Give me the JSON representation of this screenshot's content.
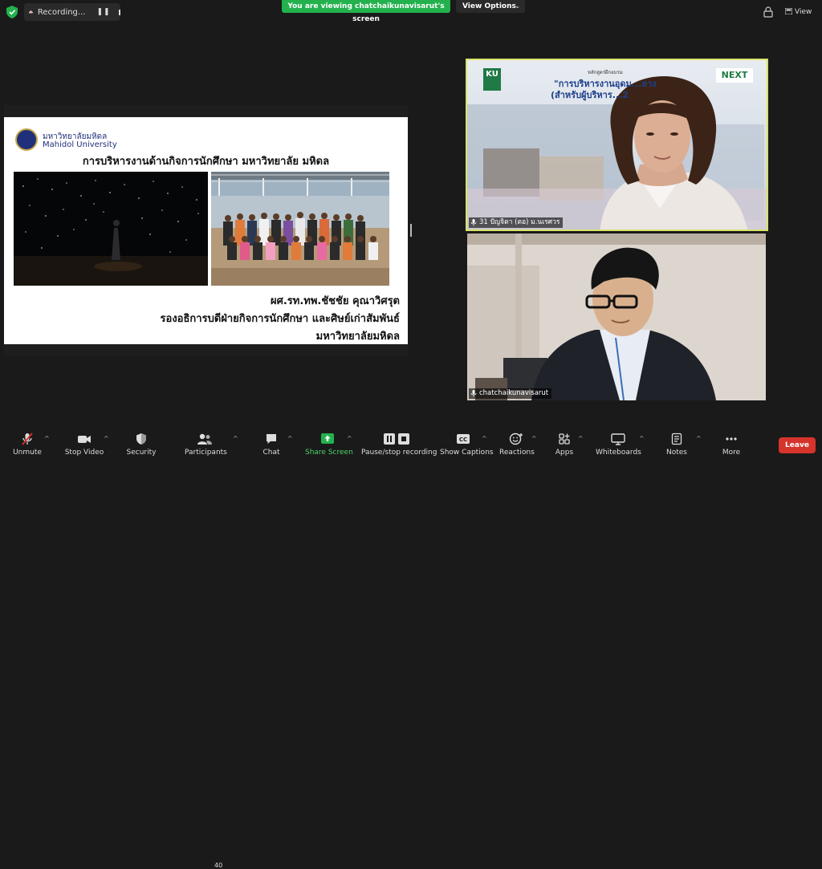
{
  "topbar": {
    "recording_label": "Recording...",
    "pause_symbol": "❚❚",
    "banner": "You are viewing chatchaikunavisarut's screen",
    "view_options": "View Options",
    "view_label": "View"
  },
  "slide": {
    "logo_thai": "มหาวิทยาลัยมหิดล",
    "logo_english": "Mahidol University",
    "title": "การบริหารงานด้านกิจการนักศึกษา มหาวิทยาลัย มหิดล",
    "presenter_name": "ผศ.รท.ทพ.ชัชชัย คุณาวิศรุต",
    "presenter_role": "รองอธิการบดีฝ่ายกิจการนักศึกษา และศิษย์เก่าสัมพันธ์",
    "presenter_org": "มหาวิทยาลัยมหิดล"
  },
  "videos": {
    "participant1_name": "31 ปัญจิตา (ตอ) ม.นเรศวร",
    "participant1_bg_caption": "หลักสูตรฝึกอบรม",
    "participant1_bg_title1": "\"การบริหารงานอุดม...ลาง",
    "participant1_bg_title2": "(สำหรับผู้บริหาร...2",
    "participant1_logo_left": "KU",
    "participant1_logo_right": "NEXT",
    "participant2_name": "chatchaikunavisarut"
  },
  "toolbar": {
    "unmute": "Unmute",
    "stop_video": "Stop Video",
    "security": "Security",
    "participants": "Participants",
    "participants_count": "40",
    "chat": "Chat",
    "share_screen": "Share Screen",
    "pause_recording": "Pause/stop recording",
    "show_captions": "Show Captions",
    "reactions": "Reactions",
    "apps": "Apps",
    "whiteboards": "Whiteboards",
    "notes": "Notes",
    "more": "More",
    "leave": "Leave"
  },
  "colors": {
    "banner_green": "#23b14d",
    "leave_red": "#d6332c",
    "active_speaker_border": "#d9e36a"
  }
}
